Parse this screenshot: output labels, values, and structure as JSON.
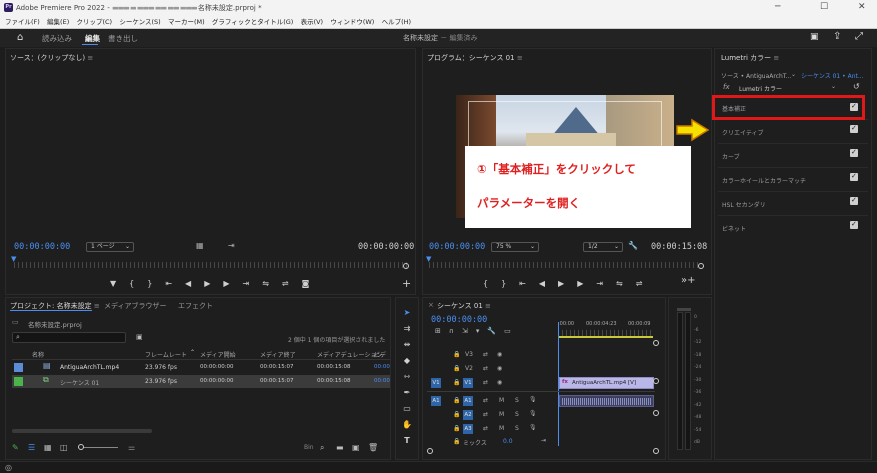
{
  "window": {
    "title": "Adobe Premiere Pro 2022 - ",
    "title_suffix": "名称未設定.prproj *",
    "minimize": "─",
    "maximize": "☐",
    "close": "✕"
  },
  "menu": [
    "ファイル(F)",
    "編集(E)",
    "クリップ(C)",
    "シーケンス(S)",
    "マーカー(M)",
    "グラフィックとタイトル(G)",
    "表示(V)",
    "ウィンドウ(W)",
    "ヘルプ(H)"
  ],
  "header": {
    "workspaces": [
      "読み込み",
      "編集",
      "書き出し"
    ],
    "project_title": "名称未設定",
    "project_status": "－ 編集済み"
  },
  "source": {
    "title": "ソース：(クリップなし)",
    "timecode_left": "00:00:00:00",
    "page_select": "1 ページ",
    "timecode_right": "00:00:00:00"
  },
  "program": {
    "title": "プログラム：シーケンス 01",
    "timecode_left": "00:00:00:00",
    "zoom": "75 %",
    "quality": "1/2",
    "timecode_right": "00:00:15:08"
  },
  "annotation": {
    "line1": "①「基本補正」をクリックして",
    "line2": "パラメーターを開く"
  },
  "lumetri": {
    "title": "Lumetri カラー",
    "source_label": "ソース • AntiguaArchT...",
    "sequence_label": "シーケンス 01 • Ant...",
    "fx_label": "Lumetri カラー",
    "sections": [
      "基本補正",
      "クリエイティブ",
      "カーブ",
      "カラーホイールとカラーマッチ",
      "HSL セカンダリ",
      "ビネット"
    ]
  },
  "project": {
    "tabs": [
      "プロジェクト: 名称未設定",
      "メディアブラウザー",
      "エフェクト"
    ],
    "file": "名称未設定.prproj",
    "search_placeholder": "",
    "selection_info": "2 個中 1 個の項目が選択されました",
    "columns": [
      "名称",
      "フレームレート",
      "メディア開始",
      "メディア終了",
      "メディアデュレーション",
      "ビデ"
    ],
    "rows": [
      {
        "name": "AntiguaArchTL.mp4",
        "fps": "23.976 fps",
        "start": "00:00:00:00",
        "end": "00:00:15:07",
        "dur": "00:00:15:08",
        "v": "00:00",
        "color": "#5b8dd6"
      },
      {
        "name": "シーケンス 01",
        "fps": "23.976 fps",
        "start": "00:00:00:00",
        "end": "00:00:15:07",
        "dur": "00:00:15:08",
        "v": "00:00",
        "color": "#4cb34c"
      }
    ]
  },
  "timeline": {
    "tab": "シーケンス 01",
    "timecode": "00:00:00:00",
    "ruler_labels": [
      ":00:00",
      "00:00:04:23",
      "00:00:09"
    ],
    "tracks_video": [
      "V3",
      "V2",
      "V1"
    ],
    "tracks_audio": [
      "A1",
      "A2",
      "A3"
    ],
    "mix_label": "ミックス",
    "mix_value": "0.0",
    "clip_label": "AntiguaArchTL.mp4 [V]"
  },
  "meter_labels": [
    "0",
    "-6",
    "-12",
    "-18",
    "-24",
    "-30",
    "-36",
    "-42",
    "-48",
    "-54",
    "dB"
  ]
}
